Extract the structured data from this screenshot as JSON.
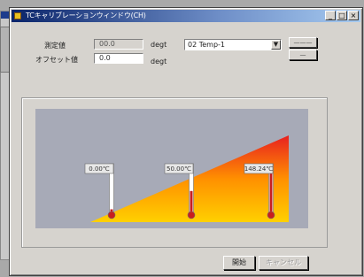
{
  "window": {
    "title": "TCキャリブレーションウィンドウ(CH)"
  },
  "title_buttons": {
    "minimize": "_",
    "maximize": "□",
    "close": "×"
  },
  "form": {
    "measured_label": "測定値",
    "measured_value": "00.0",
    "measured_unit": "degt",
    "offset_label": "オフセット値",
    "offset_value": "0.0",
    "offset_unit": "degt"
  },
  "channel_select": {
    "selected": "02  Temp-1",
    "arrow": "▼"
  },
  "side_buttons": {
    "top_label": "———",
    "bottom_label": "—"
  },
  "thermometers": [
    {
      "label": "0.00℃",
      "level": 0.08
    },
    {
      "label": "50.00℃",
      "level": 0.45
    },
    {
      "label": "148.24℃",
      "level": 0.9
    }
  ],
  "buttons": {
    "start": "開始",
    "cancel": "キャンセル"
  },
  "colors": {
    "gradient_top": "#e82020",
    "gradient_bottom": "#ffd000",
    "mercury": "#c81e1e",
    "canvas": "#a7aab7"
  }
}
